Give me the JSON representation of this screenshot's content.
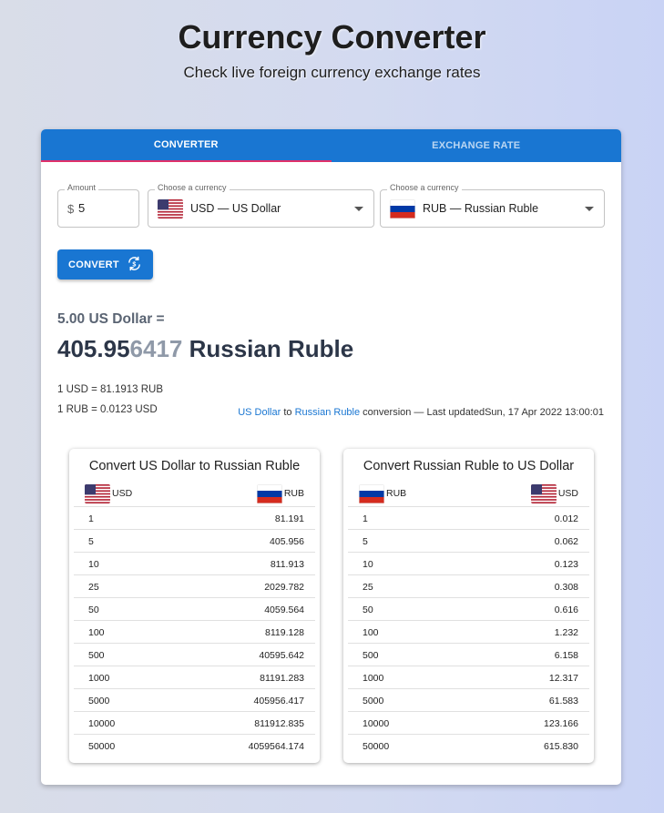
{
  "header": {
    "title": "Currency Converter",
    "subtitle": "Check live foreign currency exchange rates"
  },
  "tabs": [
    {
      "label": "CONVERTER",
      "active": true
    },
    {
      "label": "EXCHANGE RATE",
      "active": false
    }
  ],
  "converter": {
    "amount": {
      "label": "Amount",
      "prefix": "$",
      "value": "5"
    },
    "from": {
      "label": "Choose a currency",
      "value": "USD — US Dollar",
      "flag": "us-flag"
    },
    "to": {
      "label": "Choose a currency",
      "value": "RUB — Russian Ruble",
      "flag": "ru-flag"
    },
    "convert_label": "CONVERT",
    "convert_icon": "currency-exchange-icon"
  },
  "result": {
    "from_text": "5.00 US Dollar =",
    "amount_bold": "405.95",
    "amount_dim": "6417",
    "currency": " Russian Ruble",
    "rate1": "1 USD = 81.1913 RUB",
    "rate2": "1 RUB = 0.0123 USD",
    "update_from": "US Dollar",
    "update_to_word": " to ",
    "update_to": "Russian Ruble",
    "update_suffix": " conversion — Last updatedSun, 17 Apr 2022 13:00:01"
  },
  "tables": [
    {
      "title": "Convert US Dollar to Russian Ruble",
      "col1": "USD",
      "col2": "RUB",
      "rows": [
        [
          "1",
          "81.191"
        ],
        [
          "5",
          "405.956"
        ],
        [
          "10",
          "811.913"
        ],
        [
          "25",
          "2029.782"
        ],
        [
          "50",
          "4059.564"
        ],
        [
          "100",
          "8119.128"
        ],
        [
          "500",
          "40595.642"
        ],
        [
          "1000",
          "81191.283"
        ],
        [
          "5000",
          "405956.417"
        ],
        [
          "10000",
          "811912.835"
        ],
        [
          "50000",
          "4059564.174"
        ]
      ]
    },
    {
      "title": "Convert Russian Ruble to US Dollar",
      "col1": "RUB",
      "col2": "USD",
      "rows": [
        [
          "1",
          "0.012"
        ],
        [
          "5",
          "0.062"
        ],
        [
          "10",
          "0.123"
        ],
        [
          "25",
          "0.308"
        ],
        [
          "50",
          "0.616"
        ],
        [
          "100",
          "1.232"
        ],
        [
          "500",
          "6.158"
        ],
        [
          "1000",
          "12.317"
        ],
        [
          "5000",
          "61.583"
        ],
        [
          "10000",
          "123.166"
        ],
        [
          "50000",
          "615.830"
        ]
      ]
    }
  ],
  "colors": {
    "primary": "#1976d2",
    "tab_indicator": "#e0306a",
    "result_text": "#2c3648",
    "result_dim": "#8f99a8"
  }
}
